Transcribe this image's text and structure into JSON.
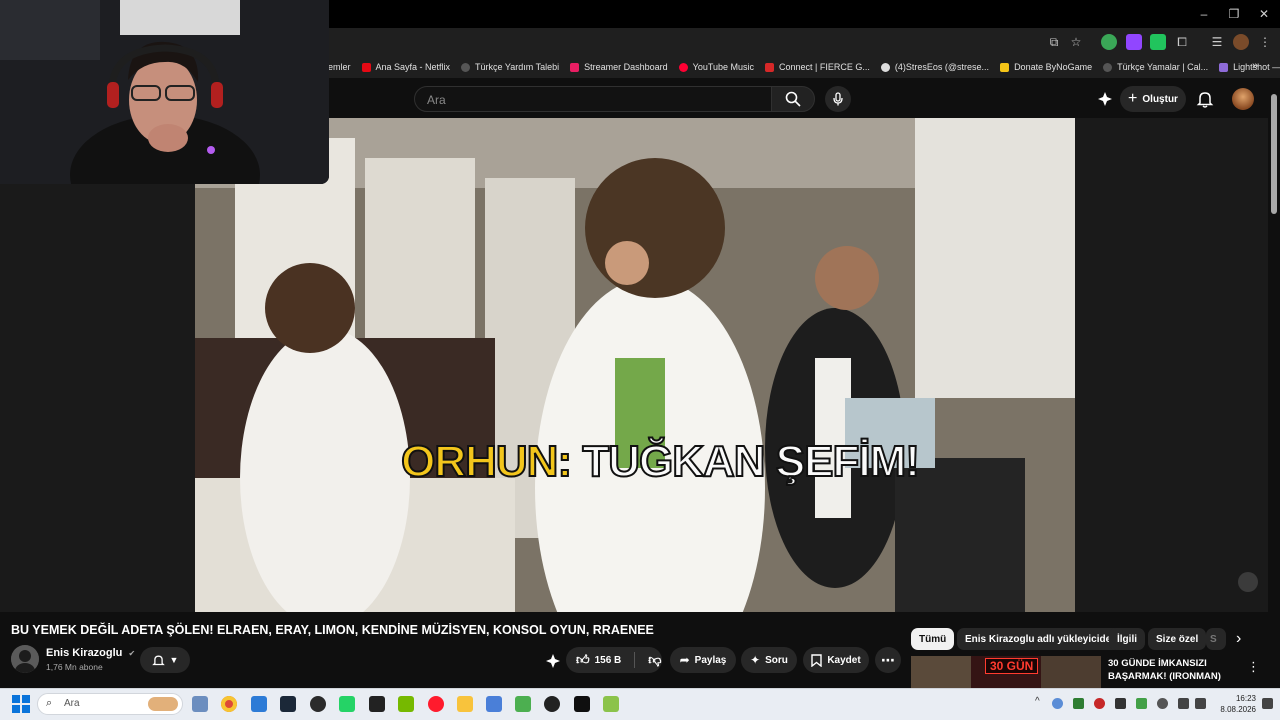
{
  "browser": {
    "bookmarks": [
      {
        "label": "emler",
        "color": "#aaaaaa"
      },
      {
        "label": "Ana Sayfa - Netflix",
        "color": "#e50914"
      },
      {
        "label": "Türkçe Yardım Talebi",
        "color": "#555555"
      },
      {
        "label": "Streamer Dashboard",
        "color": "#e91e63"
      },
      {
        "label": "YouTube Music",
        "color": "#ff0033"
      },
      {
        "label": "Connect | FIERCE G...",
        "color": "#d62828"
      },
      {
        "label": "(4)StresEos (@strese...",
        "color": "#dddddd"
      },
      {
        "label": "Donate ByNoGame",
        "color": "#f5c518"
      },
      {
        "label": "Türkçe Yamalar | Cal...",
        "color": "#555555"
      },
      {
        "label": "Lightshot — Mac &...",
        "color": "#8e6bd8"
      }
    ],
    "more_bookmarks": "»"
  },
  "youtube": {
    "search_placeholder": "Ara",
    "create_label": "Oluştur"
  },
  "video": {
    "caption_name": "ORHUN:",
    "caption_text": "TUĞKAN ŞEFİM!",
    "title": "BU YEMEK DEĞİL ADETA ŞÖLEN! ELRAEN, ERAY, LIMON, KENDİNE MÜZİSYEN, KONSOL OYUN, RRAENEE"
  },
  "channel": {
    "name": "Enis Kirazoglu",
    "verified": "✔",
    "subscribers": "1,76 Mn abone"
  },
  "actions": {
    "likes": "156 B",
    "share": "Paylaş",
    "ask": "Soru",
    "save": "Kaydet"
  },
  "chips": [
    "Tümü",
    "Enis Kirazoglu adlı yükleyiciden",
    "İlgili",
    "Size özel",
    "S"
  ],
  "recommendation": {
    "thumb_text": "30 GÜN",
    "title": "30 GÜNDE İMKANSIZI BAŞARMAK! (IRONMAN)"
  },
  "taskbar": {
    "search_placeholder": "Ara",
    "time": "16:23",
    "date": "8.08.2026"
  }
}
